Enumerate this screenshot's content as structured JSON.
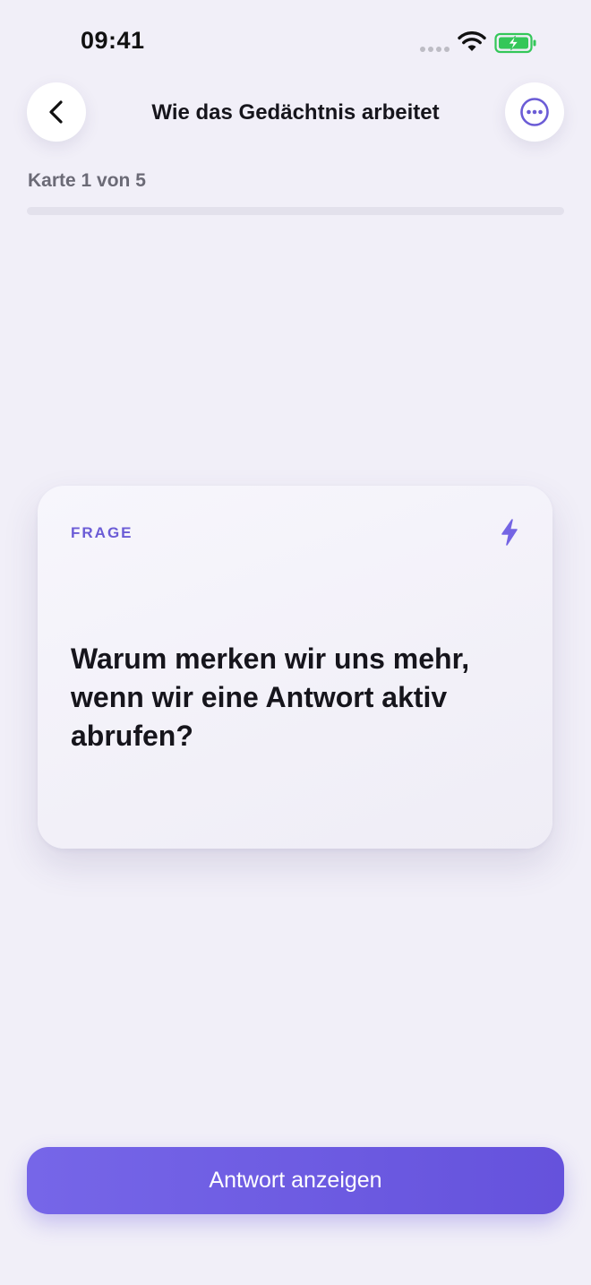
{
  "status_bar": {
    "time": "09:41"
  },
  "header": {
    "title": "Wie das Gedächtnis arbeitet"
  },
  "progress": {
    "label": "Karte 1 von 5",
    "current": 1,
    "total": 5,
    "fill_fraction": 0.0
  },
  "card": {
    "tag": "FRAGE",
    "question": "Warum merken wir uns mehr, wenn wir eine Antwort aktiv abrufen?"
  },
  "actions": {
    "primary_label": "Antwort anzeigen"
  },
  "colors": {
    "accent": "#6b5cd6",
    "button": "#6a58de",
    "background": "#f1eff8",
    "battery": "#34c759"
  },
  "icons": {
    "back": "chevron-left-icon",
    "more": "ellipsis-circle-icon",
    "card": "bolt-icon"
  }
}
